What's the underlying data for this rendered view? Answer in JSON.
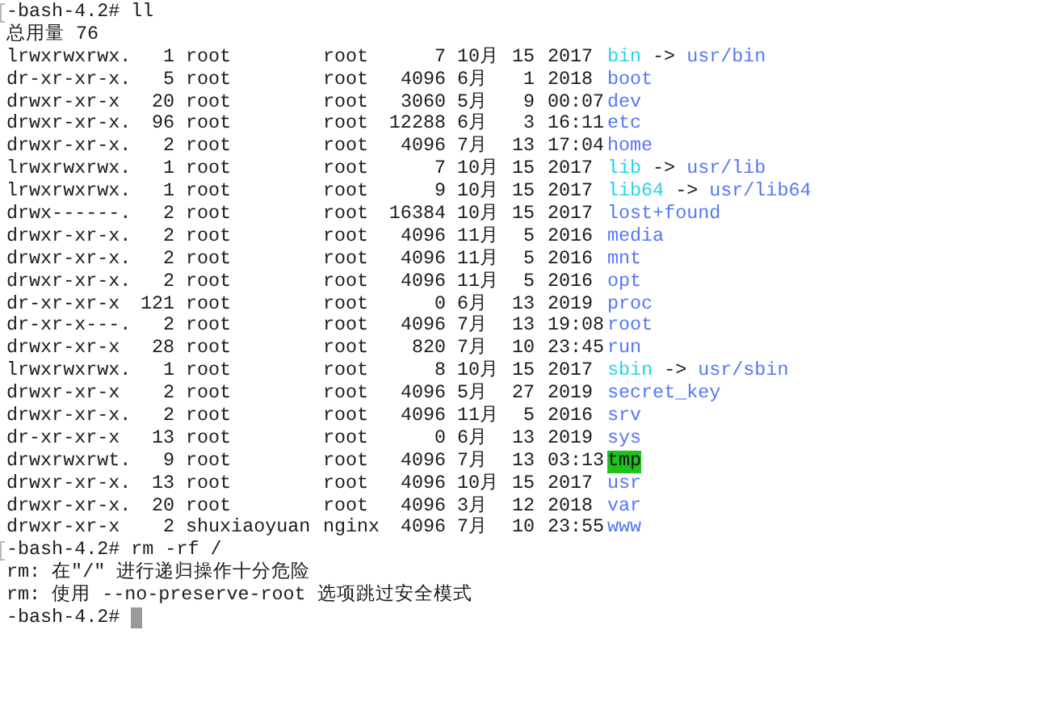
{
  "terminal": {
    "command_1": {
      "prompt": "-bash-4.2#",
      "command": "ll",
      "marked": true
    },
    "total": "总用量 76",
    "entries": [
      {
        "perms": "lrwxrwxrwx.",
        "links": "1",
        "owner": "root",
        "group": "root",
        "size": "7",
        "month": "10月",
        "day": "15",
        "time": "2017",
        "name": "bin",
        "kind": "link",
        "arrow": "->",
        "target": "usr/bin"
      },
      {
        "perms": "dr-xr-xr-x.",
        "links": "5",
        "owner": "root",
        "group": "root",
        "size": "4096",
        "month": "6月",
        "day": "1",
        "time": "2018",
        "name": "boot",
        "kind": "dir"
      },
      {
        "perms": "drwxr-xr-x",
        "links": "20",
        "owner": "root",
        "group": "root",
        "size": "3060",
        "month": "5月",
        "day": "9",
        "time": "00:07",
        "name": "dev",
        "kind": "dir"
      },
      {
        "perms": "drwxr-xr-x.",
        "links": "96",
        "owner": "root",
        "group": "root",
        "size": "12288",
        "month": "6月",
        "day": "3",
        "time": "16:11",
        "name": "etc",
        "kind": "dir"
      },
      {
        "perms": "drwxr-xr-x.",
        "links": "2",
        "owner": "root",
        "group": "root",
        "size": "4096",
        "month": "7月",
        "day": "13",
        "time": "17:04",
        "name": "home",
        "kind": "dir"
      },
      {
        "perms": "lrwxrwxrwx.",
        "links": "1",
        "owner": "root",
        "group": "root",
        "size": "7",
        "month": "10月",
        "day": "15",
        "time": "2017",
        "name": "lib",
        "kind": "link",
        "arrow": "->",
        "target": "usr/lib"
      },
      {
        "perms": "lrwxrwxrwx.",
        "links": "1",
        "owner": "root",
        "group": "root",
        "size": "9",
        "month": "10月",
        "day": "15",
        "time": "2017",
        "name": "lib64",
        "kind": "link",
        "arrow": "->",
        "target": "usr/lib64"
      },
      {
        "perms": "drwx------.",
        "links": "2",
        "owner": "root",
        "group": "root",
        "size": "16384",
        "month": "10月",
        "day": "15",
        "time": "2017",
        "name": "lost+found",
        "kind": "dir"
      },
      {
        "perms": "drwxr-xr-x.",
        "links": "2",
        "owner": "root",
        "group": "root",
        "size": "4096",
        "month": "11月",
        "day": "5",
        "time": "2016",
        "name": "media",
        "kind": "dir"
      },
      {
        "perms": "drwxr-xr-x.",
        "links": "2",
        "owner": "root",
        "group": "root",
        "size": "4096",
        "month": "11月",
        "day": "5",
        "time": "2016",
        "name": "mnt",
        "kind": "dir"
      },
      {
        "perms": "drwxr-xr-x.",
        "links": "2",
        "owner": "root",
        "group": "root",
        "size": "4096",
        "month": "11月",
        "day": "5",
        "time": "2016",
        "name": "opt",
        "kind": "dir"
      },
      {
        "perms": "dr-xr-xr-x",
        "links": "121",
        "owner": "root",
        "group": "root",
        "size": "0",
        "month": "6月",
        "day": "13",
        "time": "2019",
        "name": "proc",
        "kind": "dir"
      },
      {
        "perms": "dr-xr-x---.",
        "links": "2",
        "owner": "root",
        "group": "root",
        "size": "4096",
        "month": "7月",
        "day": "13",
        "time": "19:08",
        "name": "root",
        "kind": "dir"
      },
      {
        "perms": "drwxr-xr-x",
        "links": "28",
        "owner": "root",
        "group": "root",
        "size": "820",
        "month": "7月",
        "day": "10",
        "time": "23:45",
        "name": "run",
        "kind": "dir"
      },
      {
        "perms": "lrwxrwxrwx.",
        "links": "1",
        "owner": "root",
        "group": "root",
        "size": "8",
        "month": "10月",
        "day": "15",
        "time": "2017",
        "name": "sbin",
        "kind": "link",
        "arrow": "->",
        "target": "usr/sbin"
      },
      {
        "perms": "drwxr-xr-x",
        "links": "2",
        "owner": "root",
        "group": "root",
        "size": "4096",
        "month": "5月",
        "day": "27",
        "time": "2019",
        "name": "secret_key",
        "kind": "dir"
      },
      {
        "perms": "drwxr-xr-x.",
        "links": "2",
        "owner": "root",
        "group": "root",
        "size": "4096",
        "month": "11月",
        "day": "5",
        "time": "2016",
        "name": "srv",
        "kind": "dir"
      },
      {
        "perms": "dr-xr-xr-x",
        "links": "13",
        "owner": "root",
        "group": "root",
        "size": "0",
        "month": "6月",
        "day": "13",
        "time": "2019",
        "name": "sys",
        "kind": "dir"
      },
      {
        "perms": "drwxrwxrwt.",
        "links": "9",
        "owner": "root",
        "group": "root",
        "size": "4096",
        "month": "7月",
        "day": "13",
        "time": "03:13",
        "name": "tmp",
        "kind": "sticky"
      },
      {
        "perms": "drwxr-xr-x.",
        "links": "13",
        "owner": "root",
        "group": "root",
        "size": "4096",
        "month": "10月",
        "day": "15",
        "time": "2017",
        "name": "usr",
        "kind": "dir"
      },
      {
        "perms": "drwxr-xr-x.",
        "links": "20",
        "owner": "root",
        "group": "root",
        "size": "4096",
        "month": "3月",
        "day": "12",
        "time": "2018",
        "name": "var",
        "kind": "dir"
      },
      {
        "perms": "drwxr-xr-x",
        "links": "2",
        "owner": "shuxiaoyuan",
        "group": "nginx",
        "size": "4096",
        "month": "7月",
        "day": "10",
        "time": "23:55",
        "name": "www",
        "kind": "dir"
      }
    ],
    "command_2": {
      "prompt": "-bash-4.2#",
      "command": "rm -rf /",
      "marked": true
    },
    "output": [
      "rm: 在\"/\" 进行递归操作十分危险",
      "rm: 使用 --no-preserve-root 选项跳过安全模式"
    ],
    "command_3": {
      "prompt": "-bash-4.2#",
      "command_cursor": true,
      "marked": false
    }
  }
}
